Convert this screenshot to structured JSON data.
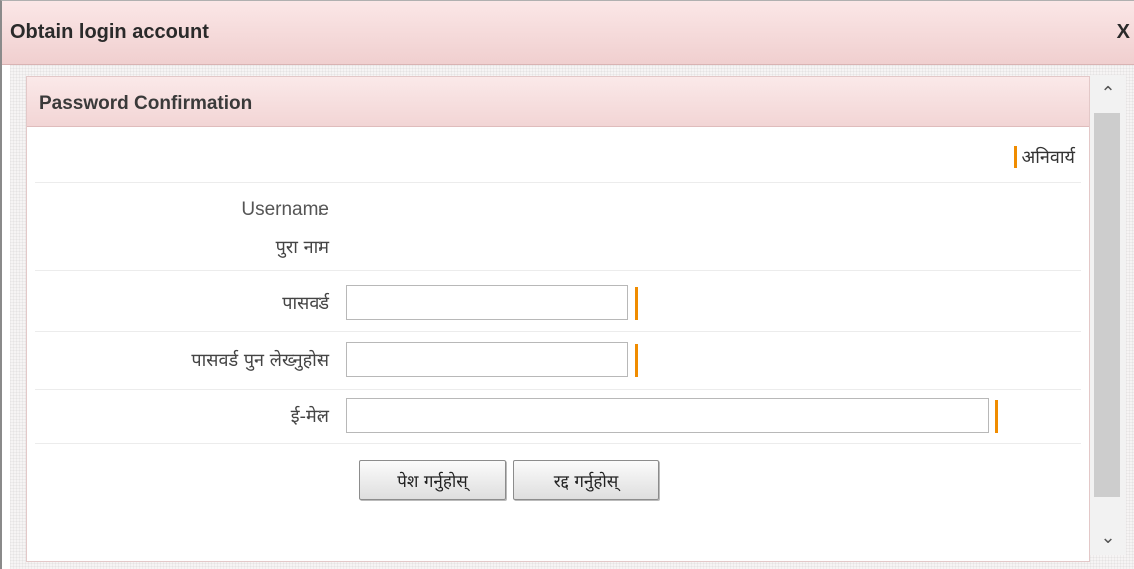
{
  "dialog": {
    "title": "Obtain login account",
    "close_label": "X"
  },
  "panel": {
    "title": "Password Confirmation",
    "required_note": "अनिवार्य"
  },
  "form": {
    "colon": ":",
    "username_label": "Username",
    "username_value": "",
    "fullname_label": "पुरा नाम",
    "fullname_value": "",
    "password_label": "पासवर्ड",
    "password_value": "",
    "confirm_label": "पासवर्ड पुन लेख्नुहोस",
    "confirm_value": "",
    "email_label": "ई-मेल",
    "email_value": ""
  },
  "buttons": {
    "submit": "पेश गर्नुहोस्",
    "cancel": "रद्द गर्नुहोस्"
  },
  "scrollbar": {
    "up_icon": "chevron-up-icon",
    "down_icon": "chevron-down-icon",
    "up_glyph": "⌃",
    "down_glyph": "⌄"
  },
  "colors": {
    "required_marker": "#f08c00",
    "header_bg": "#f2d5d5"
  }
}
